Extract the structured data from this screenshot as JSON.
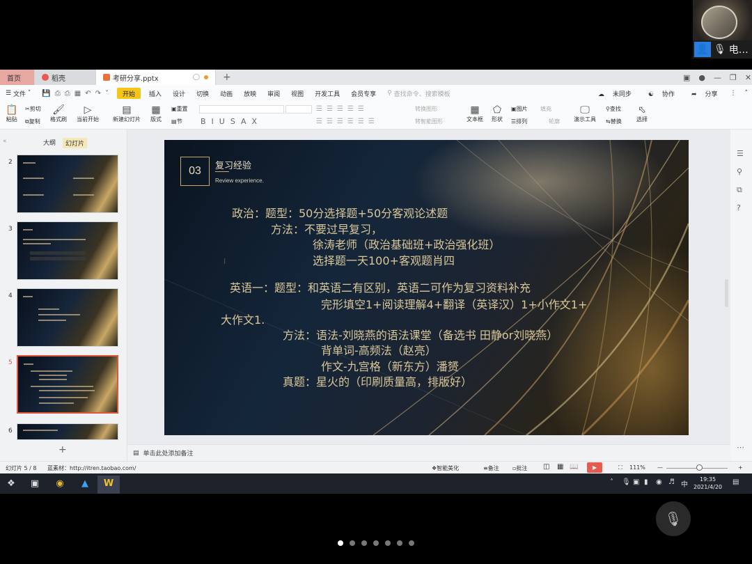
{
  "participant": {
    "name": "电…",
    "icon": "user-icon"
  },
  "tabs": [
    {
      "label": "首页"
    },
    {
      "label": "稻壳"
    },
    {
      "label": "考研分享.pptx"
    }
  ],
  "menu": {
    "file": "文件",
    "items": [
      "开始",
      "插入",
      "设计",
      "切换",
      "动画",
      "放映",
      "审阅",
      "视图",
      "开发工具",
      "会员专享"
    ],
    "search": "查找命令、搜索模板",
    "sync": "未同步",
    "collab": "协作",
    "share": "分享"
  },
  "ribbon": {
    "paste": "粘贴",
    "cut": "剪切",
    "copy": "复制",
    "format_painter": "格式刷",
    "from_current": "当前开始",
    "new_slide": "新建幻灯片",
    "layout": "版式",
    "section": "节",
    "reset": "重置",
    "convert_shape": "转换图形",
    "smart_graphic": "转智能图形",
    "textbox": "文本框",
    "shape": "形状",
    "picture": "图片",
    "fill": "填充",
    "arrange": "排列",
    "outline": "轮廓",
    "presenter": "演示工具",
    "find": "查找",
    "replace": "替换",
    "select": "选择"
  },
  "left_panel": {
    "outline_tab": "大纲",
    "slides_tab": "幻灯片",
    "slide_numbers": [
      "2",
      "3",
      "4",
      "5",
      "6"
    ],
    "selected": "5"
  },
  "slide": {
    "number": "03",
    "title": "复习经验",
    "subtitle": "Review experience.",
    "lines": [
      "政治：题型：50分选择题+50分客观论述题",
      "方法：不要过早复习，",
      "徐涛老师（政治基础班+政治强化班）",
      "选择题一天100+客观题肖四",
      "英语一：题型：和英语二有区别，英语二可作为复习资料补充",
      "完形填空1+阅读理解4+翻译（英译汉）1+小作文1+",
      "大作文1.",
      "方法：语法-刘晓燕的语法课堂（备选书 田静or刘晓燕）",
      "背单词-高频法（赵亮）",
      "作文-九宫格（新东方）潘赟",
      "真题：星火的（印刷质量高，排版好）"
    ]
  },
  "notes_placeholder": "单击此处添加备注",
  "status": {
    "slide_count": "幻灯片 5 / 8",
    "theme": "蓝素材：http://itren.taobao.com/",
    "beautify": "智能美化",
    "notes": "备注",
    "comments": "批注",
    "zoom": "111%"
  },
  "taskbar": {
    "ime": "中",
    "time": "19:35",
    "date": "2021/4/20"
  },
  "pager": {
    "count": 7,
    "active": 0
  }
}
